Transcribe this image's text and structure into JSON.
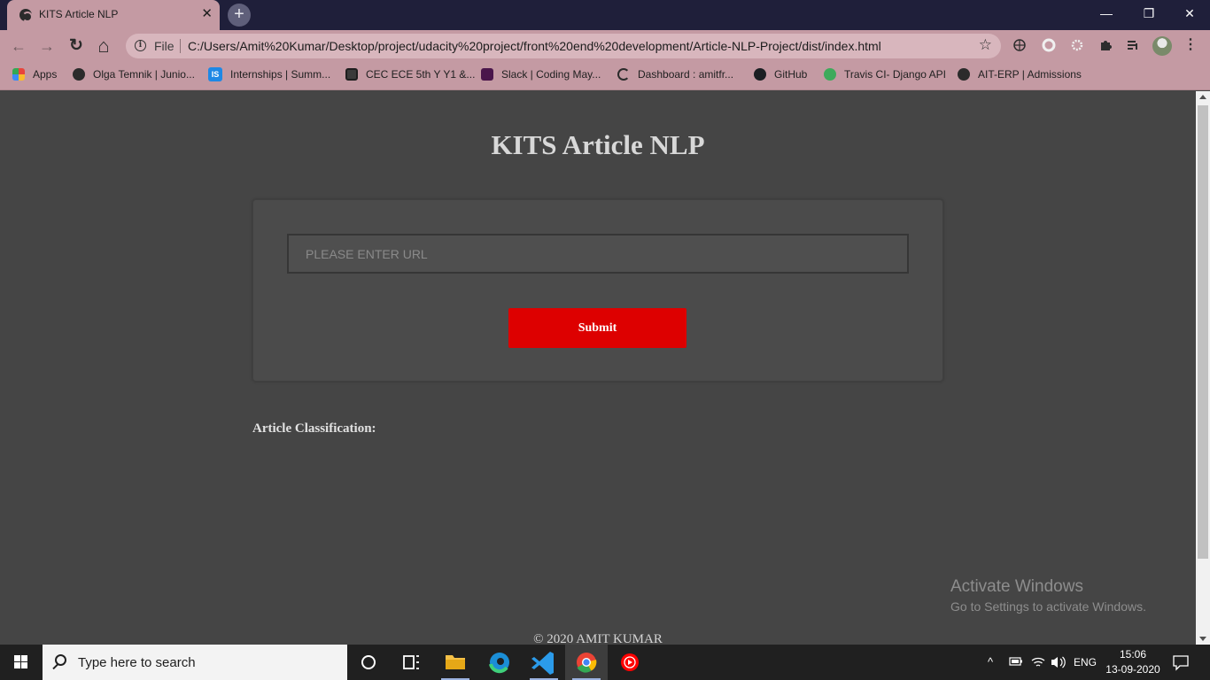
{
  "browser": {
    "tab_title": "KITS Article NLP",
    "tab_close": "✕",
    "new_tab": "+",
    "window_controls": {
      "minimize": "—",
      "restore": "❐",
      "close": "✕"
    },
    "nav": {
      "back": "←",
      "forward": "→",
      "reload": "↻",
      "home": "⌂"
    },
    "omnibox": {
      "info": "i",
      "scheme_label": "File",
      "url": "C:/Users/Amit%20Kumar/Desktop/project/udacity%20project/front%20end%20development/Article-NLP-Project/dist/index.html",
      "star": "☆"
    },
    "menu": "⋮"
  },
  "bookmarks": [
    {
      "label": "Apps",
      "icon": "apps-grid-icon",
      "color": "#e8453c"
    },
    {
      "label": "Olga Temnik | Junio...",
      "icon": "globe-icon",
      "color": "#2b2b2b"
    },
    {
      "label": "Internships | Summ...",
      "icon": "is-icon",
      "color": "#1e88e5"
    },
    {
      "label": "CEC ECE 5th Y Y1 &...",
      "icon": "classroom-icon",
      "color": "#3a3a3a"
    },
    {
      "label": "Slack | Coding May...",
      "icon": "slack-icon",
      "color": "#4a154b"
    },
    {
      "label": "Dashboard : amitfr...",
      "icon": "dashboard-icon",
      "color": "#2b2b2b"
    },
    {
      "label": "GitHub",
      "icon": "github-icon",
      "color": "#1b1f23"
    },
    {
      "label": "Travis CI- Django API",
      "icon": "travis-icon",
      "color": "#3eaa5b"
    },
    {
      "label": "AIT-ERP | Admissions",
      "icon": "globe-icon",
      "color": "#2b2b2b"
    }
  ],
  "page": {
    "title": "KITS Article NLP",
    "url_input": {
      "placeholder": "PLEASE ENTER URL",
      "value": ""
    },
    "submit_label": "Submit",
    "result_label": "Article Classification:",
    "footer": "© 2020 AMIT KUMAR"
  },
  "watermark": {
    "line1": "Activate Windows",
    "line2": "Go to Settings to activate Windows."
  },
  "taskbar": {
    "search_placeholder": "Type here to search",
    "apps": [
      "cortana-icon",
      "task-view-icon",
      "file-explorer-icon",
      "edge-icon",
      "vscode-icon",
      "chrome-icon",
      "youtube-music-icon"
    ],
    "tray": {
      "chevron": "^",
      "language": "ENG"
    },
    "clock": {
      "time": "15:06",
      "date": "13-09-2020"
    }
  },
  "colors": {
    "chrome_frame": "#c49aa3",
    "titlebar": "#1f1f3a",
    "page_bg": "#454545",
    "submit_bg": "#dd0000",
    "taskbar": "#202020"
  }
}
